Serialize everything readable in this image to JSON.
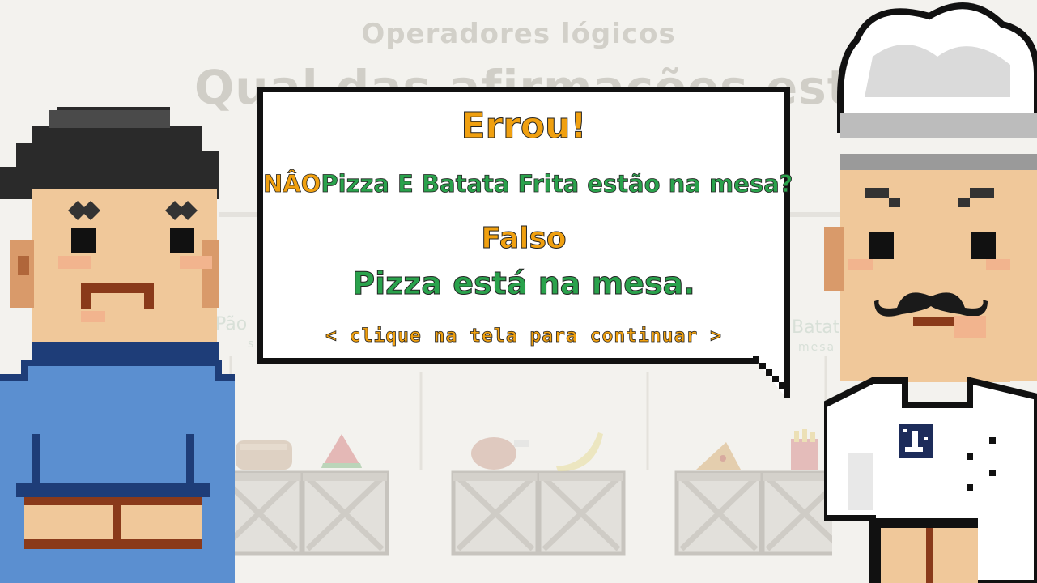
{
  "background": {
    "subtitle": "Operadores lógicos",
    "question": "Qual das afirmações está correta?",
    "option_left": {
      "label": "Pão",
      "sub": "s"
    },
    "option_right": {
      "label": "Batata Frit",
      "sub": "mesa"
    }
  },
  "dialog": {
    "headline": "Errou!",
    "proposition_not": "NÂO",
    "proposition_rest": "Pizza E Batata Frita estão na mesa?",
    "value": "Falso",
    "explanation": "Pizza está na mesa.",
    "continue_hint": "< clique na tela para continuar >"
  },
  "colors": {
    "accent_orange": "#f0a010",
    "accent_green": "#2aa24c",
    "outline": "#111111",
    "player_shirt": "#5b8fd0",
    "chef_jacket": "#ffffff"
  },
  "icons": [
    "crate-icon",
    "bread-icon",
    "watermelon-icon",
    "chicken-icon",
    "banana-icon",
    "pizza-icon",
    "fries-icon",
    "chef-badge-icon"
  ]
}
